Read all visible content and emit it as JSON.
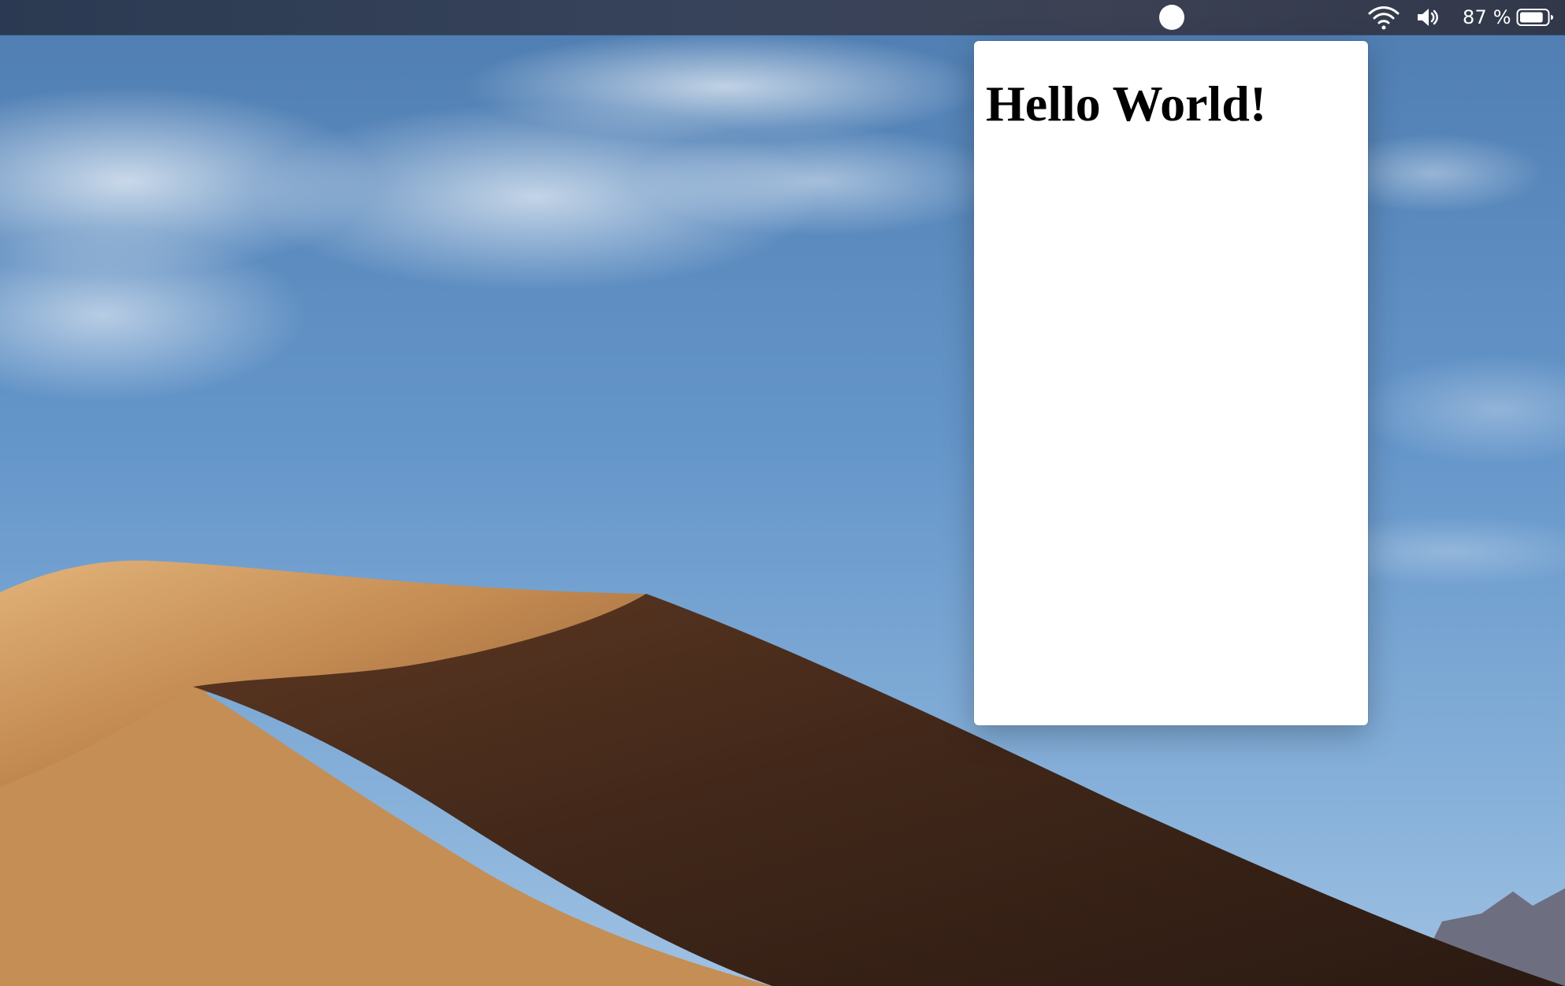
{
  "menubar": {
    "status_item_icon": "circle-icon",
    "wifi_icon": "wifi-icon",
    "volume_icon": "speaker-icon",
    "battery_text": "87 %",
    "battery_icon": "battery-icon",
    "battery_level": 0.87
  },
  "popover": {
    "title": "Hello World!"
  },
  "colors": {
    "menubar": "#37435a",
    "sky": "#6597cb",
    "dune_light": "#d5a56d",
    "dune_shadow": "#3c2519",
    "popover_bg": "#ffffff"
  }
}
